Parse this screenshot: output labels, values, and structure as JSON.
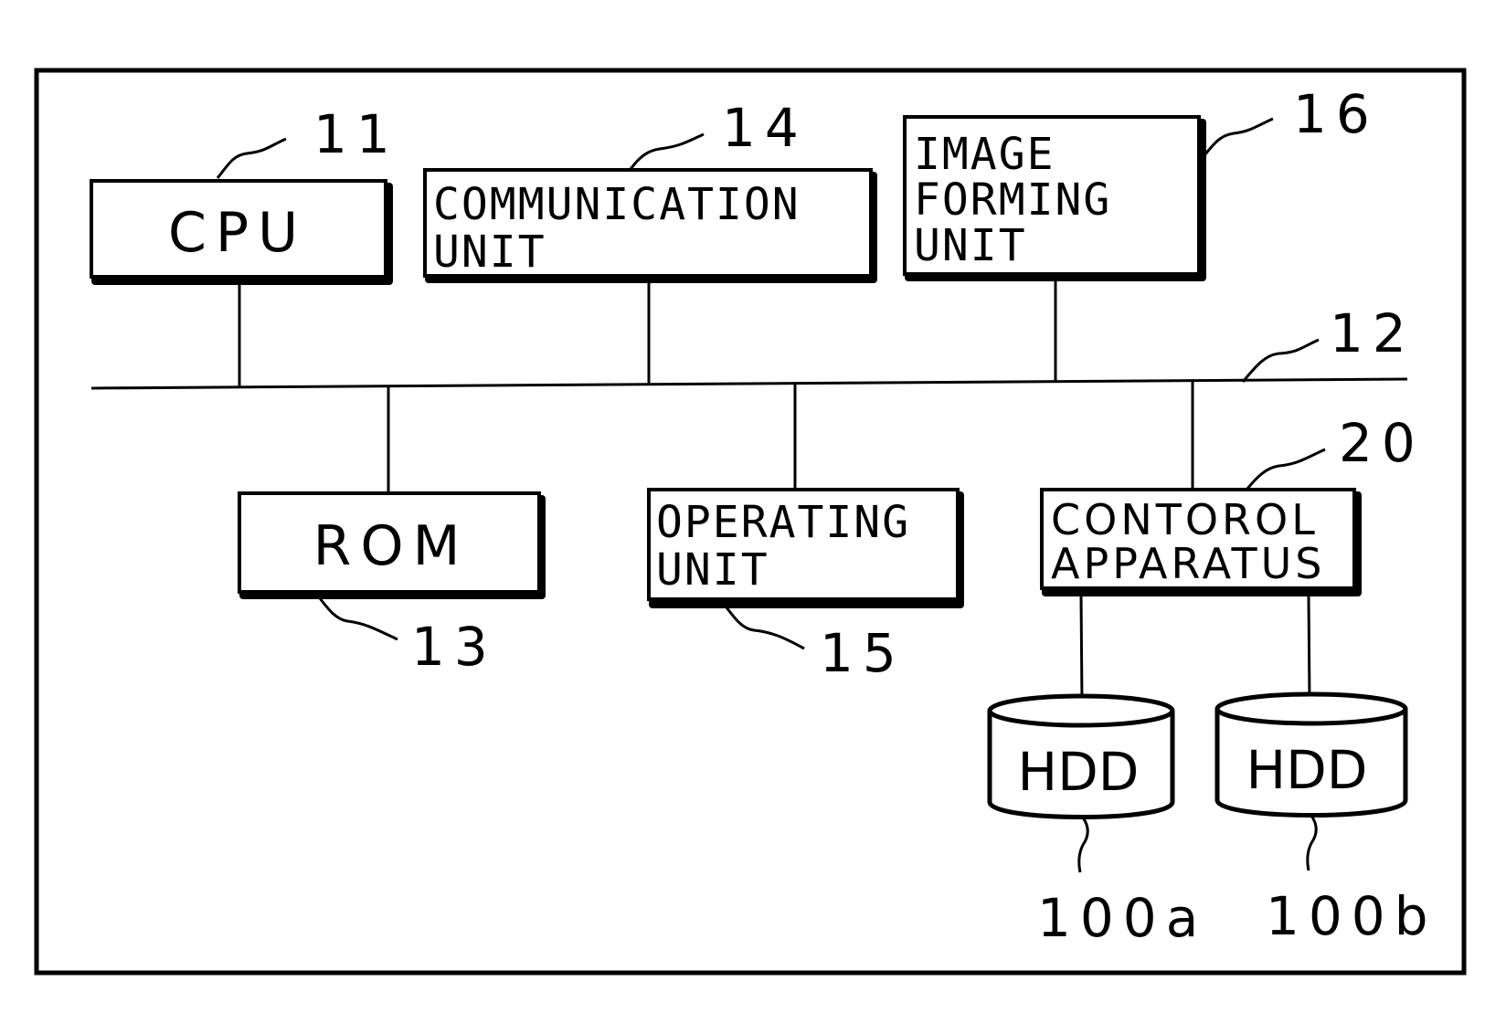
{
  "diagram": {
    "blocks": {
      "cpu": {
        "label": "CPU",
        "ref": "11"
      },
      "communication": {
        "line1": "COMMUNICATION",
        "line2": "UNIT",
        "ref": "14"
      },
      "image_forming": {
        "line1": "IMAGE",
        "line2": "FORMING",
        "line3": "UNIT",
        "ref": "16"
      },
      "bus": {
        "ref": "12"
      },
      "rom": {
        "label": "ROM",
        "ref": "13"
      },
      "operating": {
        "line1": "OPERATING",
        "line2": "UNIT",
        "ref": "15"
      },
      "control": {
        "line1": "CONTOROL",
        "line2": "APPARATUS",
        "ref": "20"
      },
      "hdd_a": {
        "label": "HDD",
        "ref": "100a"
      },
      "hdd_b": {
        "label": "HDD",
        "ref": "100b"
      }
    }
  }
}
